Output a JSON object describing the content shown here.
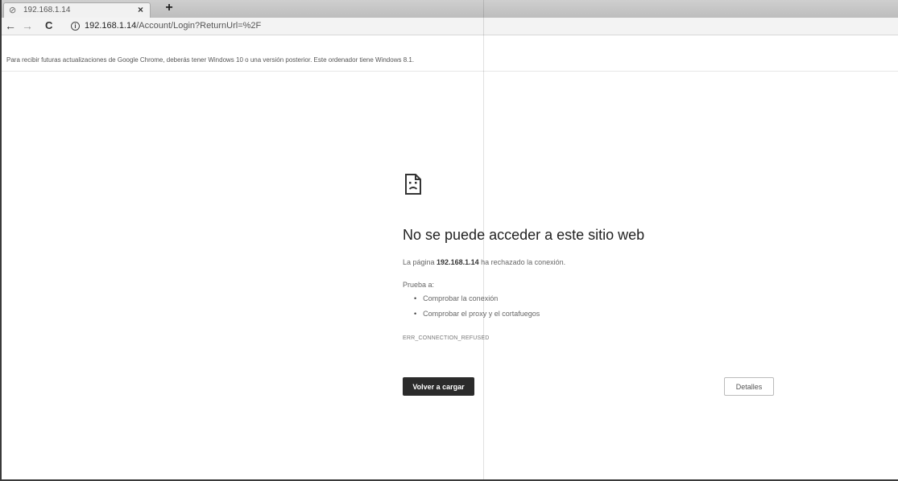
{
  "tab": {
    "title": "192.168.1.14",
    "close_label": "×",
    "new_tab_label": "+"
  },
  "toolbar": {
    "back_icon": "←",
    "forward_icon": "→",
    "reload_icon": "C",
    "url_host": "192.168.1.14",
    "url_path": "/Account/Login?ReturnUrl=%2F"
  },
  "infobar": {
    "message": "Para recibir futuras actualizaciones de Google Chrome, deberás tener Windows 10 o una versión posterior. Este ordenador tiene Windows 8.1."
  },
  "error": {
    "title": "No se puede acceder a este sitio web",
    "line_prefix": "La página ",
    "line_host": "192.168.1.14",
    "line_suffix": " ha rechazado la conexión.",
    "try_label": "Prueba a:",
    "suggestions": [
      "Comprobar la conexión",
      "Comprobar el proxy y el cortafuegos"
    ],
    "code": "ERR_CONNECTION_REFUSED",
    "reload_label": "Volver a cargar",
    "details_label": "Detalles"
  },
  "icons": {
    "tab_favicon": "globe-icon",
    "site_info": "info-icon",
    "error_illustration": "sad-page-icon"
  }
}
